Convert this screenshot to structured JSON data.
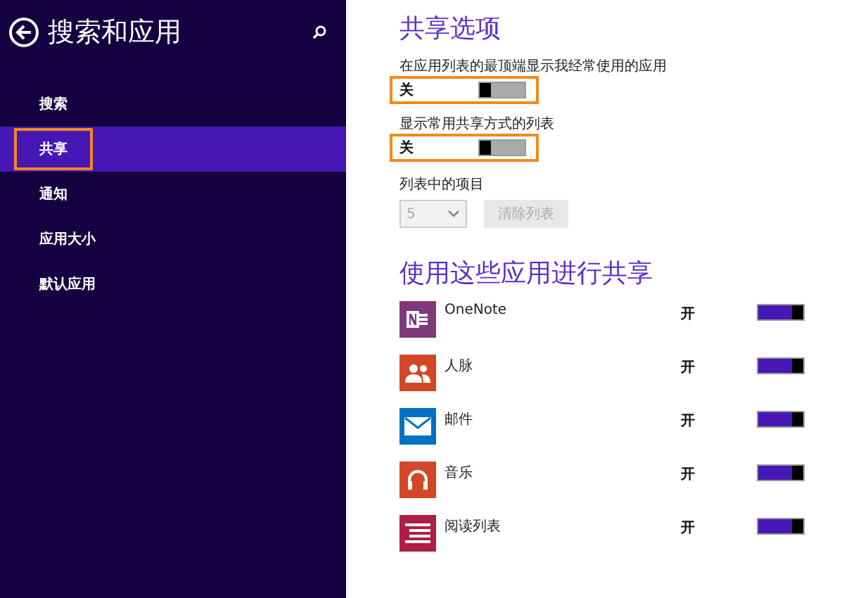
{
  "sidebar": {
    "title": "搜索和应用",
    "items": [
      {
        "label": "搜索",
        "selected": false,
        "highlighted": false
      },
      {
        "label": "共享",
        "selected": true,
        "highlighted": true
      },
      {
        "label": "通知",
        "selected": false,
        "highlighted": false
      },
      {
        "label": "应用大小",
        "selected": false,
        "highlighted": false
      },
      {
        "label": "默认应用",
        "selected": false,
        "highlighted": false
      }
    ]
  },
  "options": {
    "heading": "共享选项",
    "toggles": [
      {
        "label": "在应用列表的最顶端显示我经常使用的应用",
        "state_text": "关",
        "on": false,
        "highlighted": true
      },
      {
        "label": "显示常用共享方式的列表",
        "state_text": "关",
        "on": false,
        "highlighted": true
      }
    ],
    "items_label": "列表中的项目",
    "items_value": "5",
    "items_disabled": true,
    "clear_button": "清除列表",
    "clear_disabled": true
  },
  "apps": {
    "heading": "使用这些应用进行共享",
    "list": [
      {
        "kind": "onenote",
        "name": "OneNote",
        "state_text": "开",
        "on": true,
        "color": "#80397b"
      },
      {
        "kind": "people",
        "name": "人脉",
        "state_text": "开",
        "on": true,
        "color": "#d24726"
      },
      {
        "kind": "mail",
        "name": "邮件",
        "state_text": "开",
        "on": true,
        "color": "#0072c6"
      },
      {
        "kind": "music",
        "name": "音乐",
        "state_text": "开",
        "on": true,
        "color": "#d24726"
      },
      {
        "kind": "reading",
        "name": "阅读列表",
        "state_text": "开",
        "on": true,
        "color": "#b01e45"
      }
    ]
  }
}
